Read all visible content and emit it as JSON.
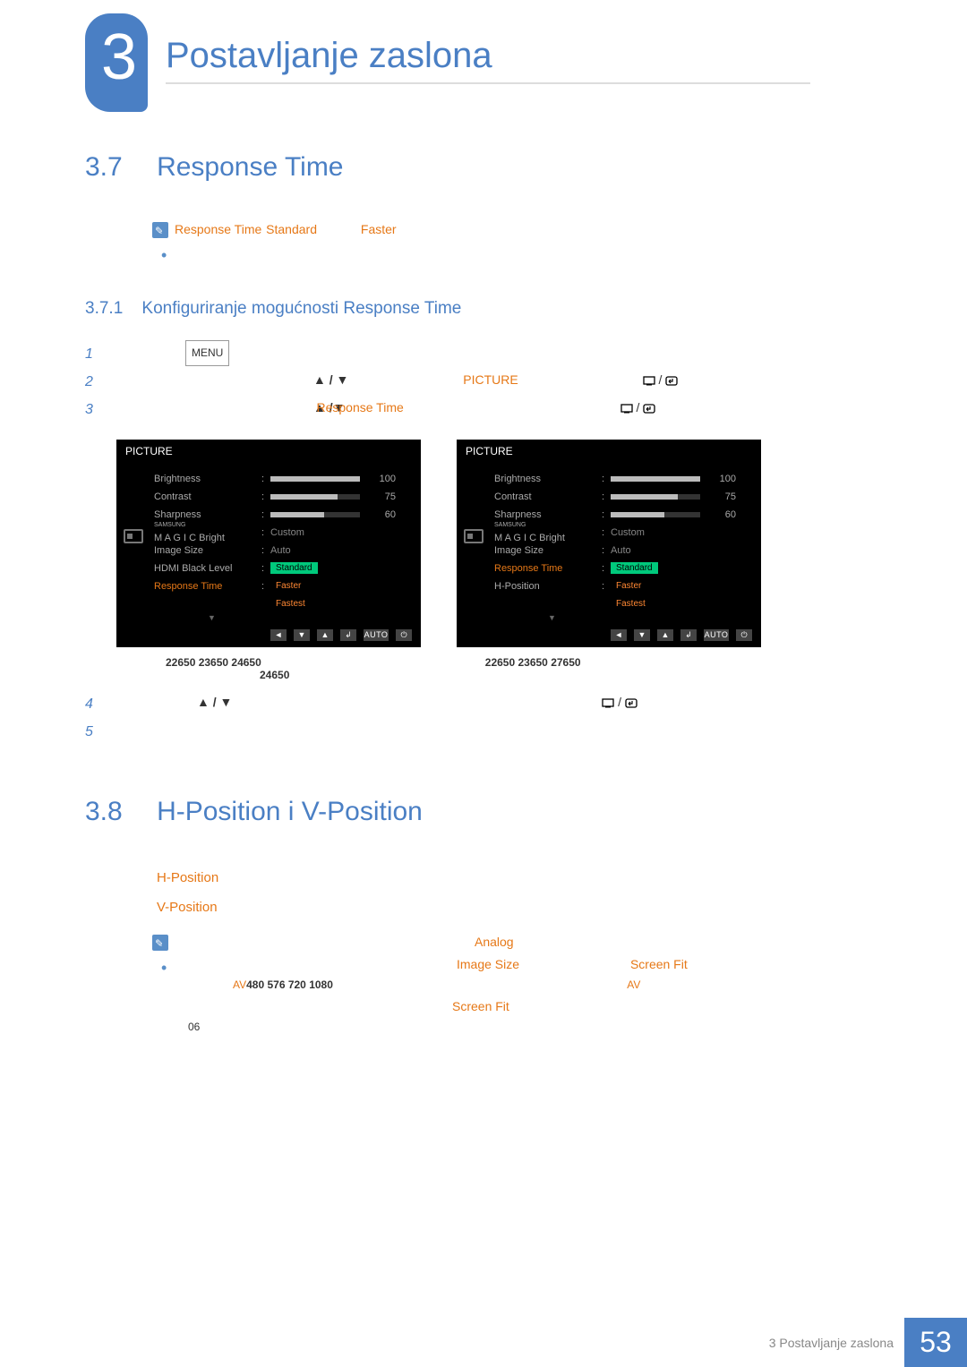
{
  "header": {
    "chapterNumber": "3",
    "chapterTitle": "Postavljanje zaslona"
  },
  "section37": {
    "num": "3.7",
    "title": "Response Time",
    "note1": {
      "rt": "Response Time",
      "std": "Standard",
      "faster": "Faster"
    },
    "subsectionNum": "3.7.1",
    "subsectionTitle": "Konfiguriranje mogućnosti Response Time",
    "step1num": "1",
    "step1btn": "MENU",
    "step2num": "2",
    "step2picture": "PICTURE",
    "step3num": "3",
    "step3rt": "Response Time",
    "step4num": "4",
    "step5num": "5",
    "models1": "22650 23650 24650",
    "models1b": "24650",
    "models2": "22650 23650 27650"
  },
  "osd": {
    "title": "PICTURE",
    "brightness": {
      "label": "Brightness",
      "value": "100",
      "fill": 100
    },
    "contrast": {
      "label": "Contrast",
      "value": "75",
      "fill": 75
    },
    "sharpness": {
      "label": "Sharpness",
      "value": "60",
      "fill": 60
    },
    "magicBright": {
      "label": "Bright",
      "prefix": "M A G I C",
      "value": "Custom"
    },
    "imageSize": {
      "label": "Image Size",
      "value": "Auto"
    },
    "hdmiBlack": {
      "label": "HDMI Black Level"
    },
    "responseTime": {
      "label": "Response Time"
    },
    "hPosition": {
      "label": "H-Position"
    },
    "opts": {
      "standard": "Standard",
      "faster": "Faster",
      "fastest": "Fastest"
    },
    "auto": "AUTO"
  },
  "section38": {
    "num": "3.8",
    "title": "H-Position i V-Position",
    "hpos": "H-Position",
    "vpos": "V-Position",
    "analog": "Analog",
    "imageSize": "Image Size",
    "screenFit": "Screen Fit",
    "avModels": "480 576 720 1080",
    "av": "AV",
    "note06": "06"
  },
  "footer": {
    "label": "3 Postavljanje zaslona",
    "page": "53"
  }
}
